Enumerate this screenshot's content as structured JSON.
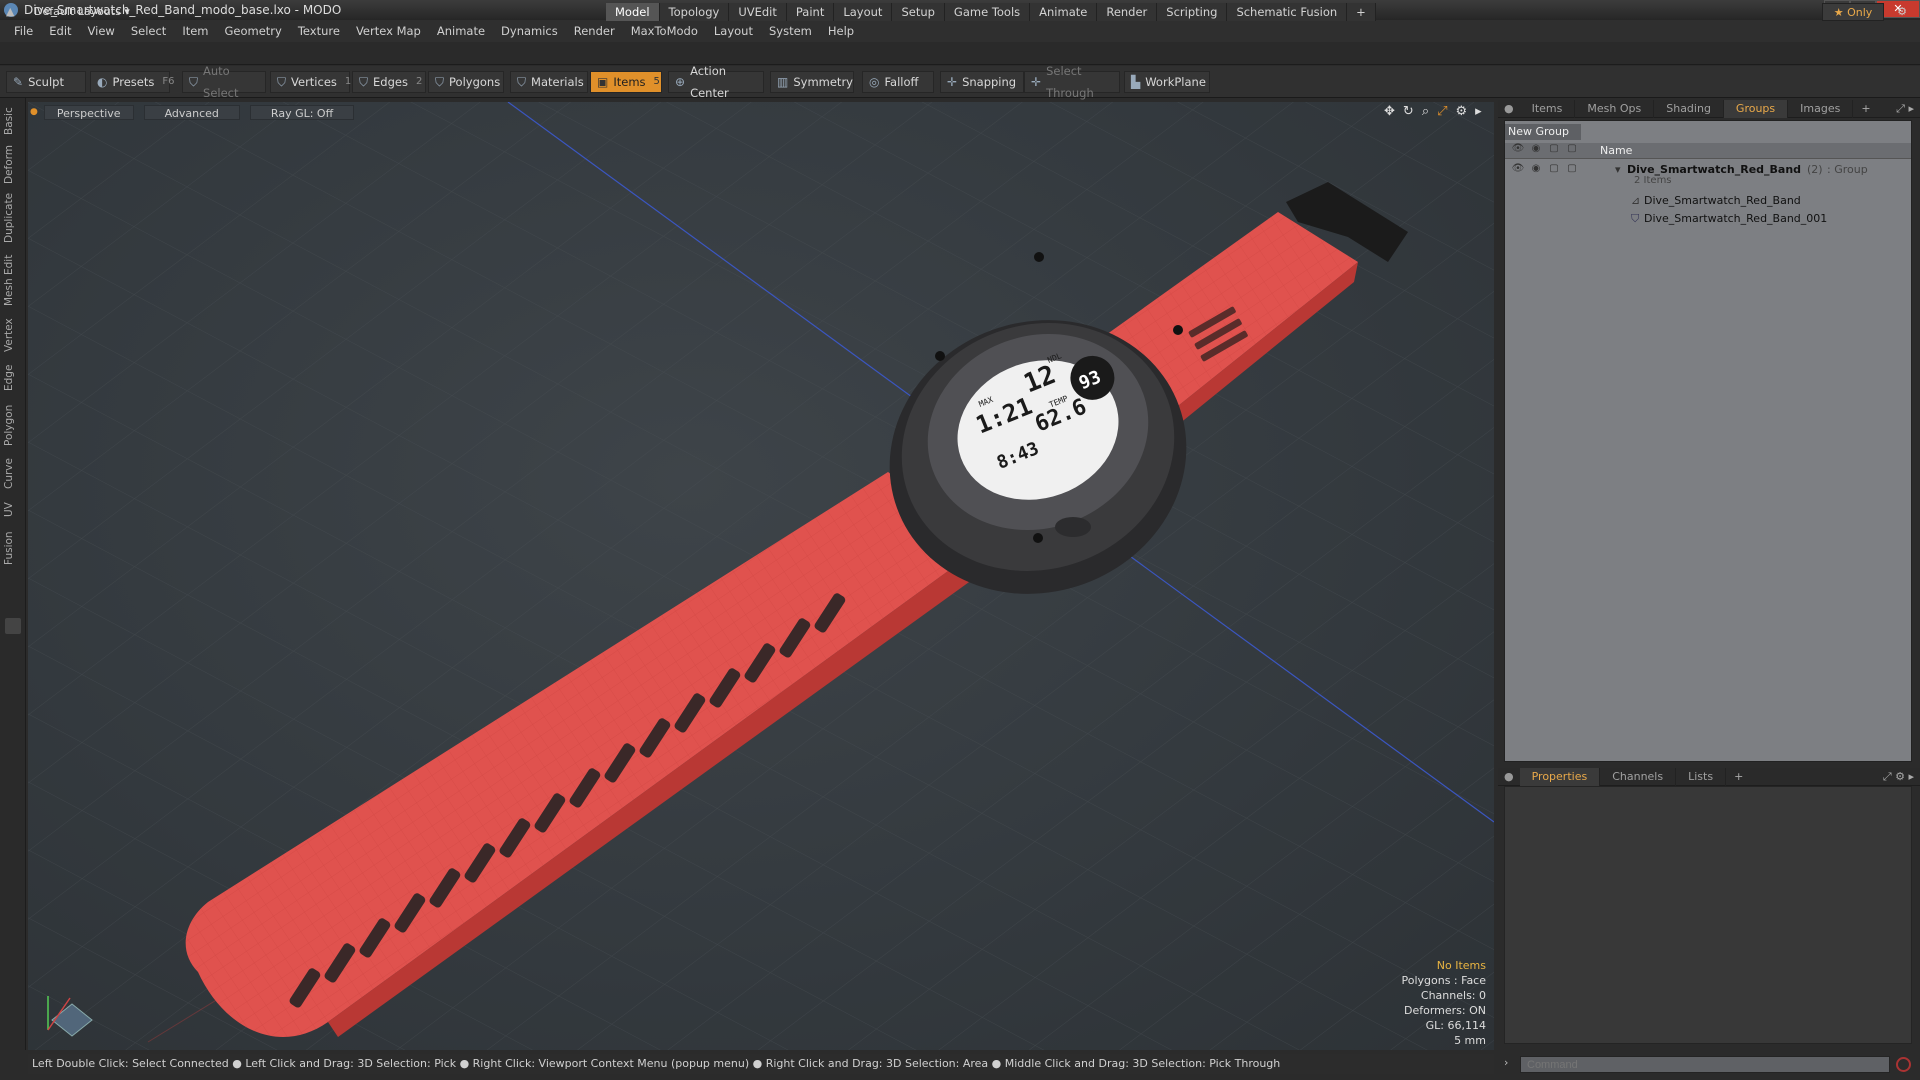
{
  "window": {
    "title": "Dive_Smartwatch_Red_Band_modo_base.lxo - MODO",
    "controls": [
      "—",
      "❐",
      "✕"
    ]
  },
  "menu": [
    "File",
    "Edit",
    "View",
    "Select",
    "Item",
    "Geometry",
    "Texture",
    "Vertex Map",
    "Animate",
    "Dynamics",
    "Render",
    "MaxToModo",
    "Layout",
    "System",
    "Help"
  ],
  "layout": {
    "selector": "Default Layouts ▾",
    "tabs": [
      "Model",
      "Topology",
      "UVEdit",
      "Paint",
      "Layout",
      "Setup",
      "Game Tools",
      "Animate",
      "Render",
      "Scripting",
      "Schematic Fusion",
      "+"
    ],
    "active_tab": "Model",
    "only": "★ Only"
  },
  "toolbar": {
    "sculpt": "Sculpt",
    "presets": "Presets",
    "presets_key": "F6",
    "auto_select": "Auto Select",
    "vertices": "Vertices",
    "vertices_key": "1",
    "edges": "Edges",
    "edges_key": "2",
    "polygons": "Polygons",
    "materials": "Materials",
    "items": "Items",
    "items_key": "5",
    "action_center": "Action Center",
    "symmetry": "Symmetry",
    "falloff": "Falloff",
    "snapping": "Snapping",
    "select_through": "Select Through",
    "workplane": "WorkPlane"
  },
  "left_tabs": [
    "Basic",
    "Deform",
    "Duplicate",
    "Mesh Edit",
    "Vertex",
    "Edge",
    "Polygon",
    "Curve",
    "UV",
    "Fusion"
  ],
  "viewport": {
    "view": "Perspective",
    "advanced": "Advanced",
    "raygl": "Ray GL: Off",
    "watch_face": {
      "top_left": "1:21",
      "top_right": "12",
      "right_circle": "93",
      "mid": "62.6",
      "bottom": "8:43",
      "label1": "MAX",
      "label2": "NDL",
      "label3": "TEMP"
    },
    "hud": {
      "items": "No Items",
      "polygons": "Polygons : Face",
      "channels": "Channels: 0",
      "deformers": "Deformers: ON",
      "gl": "GL: 66,114",
      "scale": "5 mm"
    },
    "colors": {
      "band": "#e0524e",
      "band_dark": "#b93834",
      "case": "#3a3a3c"
    }
  },
  "right_panel": {
    "top_tabs": [
      "Items",
      "Mesh Ops",
      "Shading",
      "Groups",
      "Images",
      "+"
    ],
    "active_top": "Groups",
    "new_group": "New Group",
    "col_name": "Name",
    "group": {
      "name": "Dive_Smartwatch_Red_Band",
      "count": "(2)",
      "type": ": Group",
      "sub": "2 Items"
    },
    "children": [
      "Dive_Smartwatch_Red_Band",
      "Dive_Smartwatch_Red_Band_001"
    ],
    "bottom_tabs": [
      "Properties",
      "Channels",
      "Lists",
      "+"
    ],
    "active_bottom": "Properties"
  },
  "status": "Left Double Click: Select Connected ● Left Click and Drag: 3D Selection: Pick ● Right Click: Viewport Context Menu (popup menu) ● Right Click and Drag: 3D Selection: Area ● Middle Click and Drag: 3D Selection: Pick Through",
  "command": {
    "placeholder": "Command"
  }
}
